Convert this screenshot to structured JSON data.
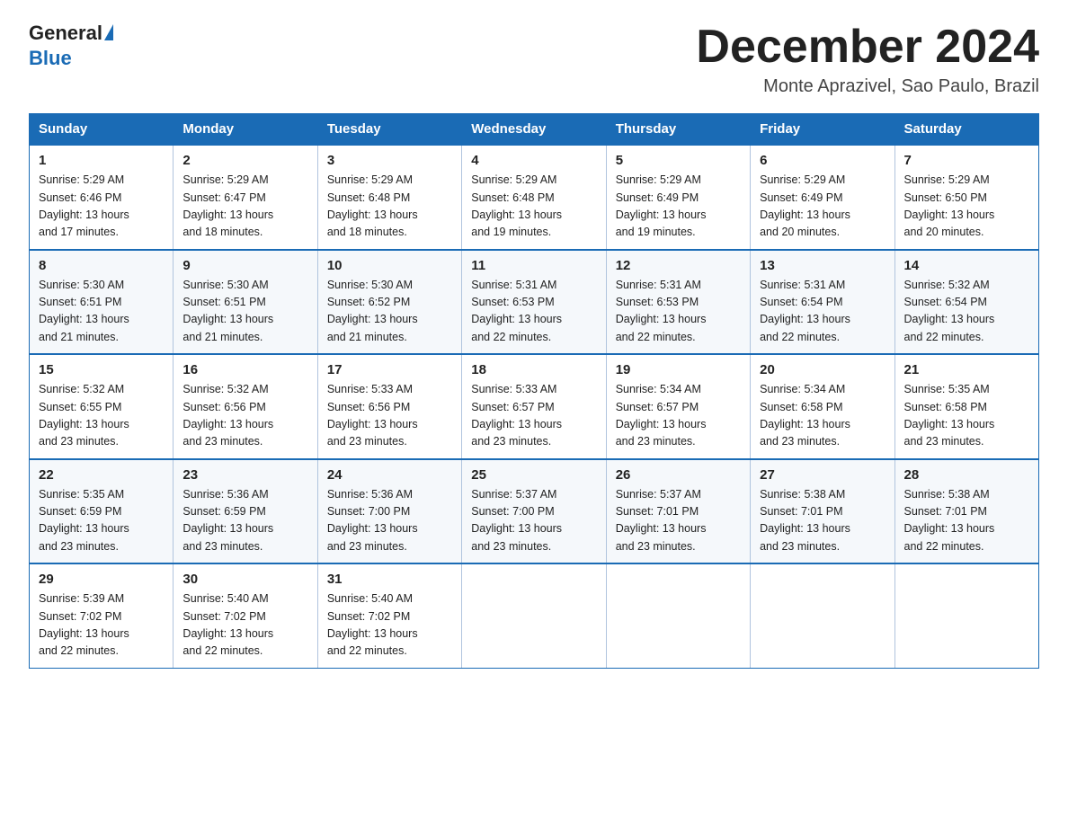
{
  "header": {
    "logo_general": "General",
    "logo_blue": "Blue",
    "month_title": "December 2024",
    "subtitle": "Monte Aprazivel, Sao Paulo, Brazil"
  },
  "weekdays": [
    "Sunday",
    "Monday",
    "Tuesday",
    "Wednesday",
    "Thursday",
    "Friday",
    "Saturday"
  ],
  "weeks": [
    [
      {
        "day": "1",
        "sunrise": "5:29 AM",
        "sunset": "6:46 PM",
        "daylight": "13 hours and 17 minutes."
      },
      {
        "day": "2",
        "sunrise": "5:29 AM",
        "sunset": "6:47 PM",
        "daylight": "13 hours and 18 minutes."
      },
      {
        "day": "3",
        "sunrise": "5:29 AM",
        "sunset": "6:48 PM",
        "daylight": "13 hours and 18 minutes."
      },
      {
        "day": "4",
        "sunrise": "5:29 AM",
        "sunset": "6:48 PM",
        "daylight": "13 hours and 19 minutes."
      },
      {
        "day": "5",
        "sunrise": "5:29 AM",
        "sunset": "6:49 PM",
        "daylight": "13 hours and 19 minutes."
      },
      {
        "day": "6",
        "sunrise": "5:29 AM",
        "sunset": "6:49 PM",
        "daylight": "13 hours and 20 minutes."
      },
      {
        "day": "7",
        "sunrise": "5:29 AM",
        "sunset": "6:50 PM",
        "daylight": "13 hours and 20 minutes."
      }
    ],
    [
      {
        "day": "8",
        "sunrise": "5:30 AM",
        "sunset": "6:51 PM",
        "daylight": "13 hours and 21 minutes."
      },
      {
        "day": "9",
        "sunrise": "5:30 AM",
        "sunset": "6:51 PM",
        "daylight": "13 hours and 21 minutes."
      },
      {
        "day": "10",
        "sunrise": "5:30 AM",
        "sunset": "6:52 PM",
        "daylight": "13 hours and 21 minutes."
      },
      {
        "day": "11",
        "sunrise": "5:31 AM",
        "sunset": "6:53 PM",
        "daylight": "13 hours and 22 minutes."
      },
      {
        "day": "12",
        "sunrise": "5:31 AM",
        "sunset": "6:53 PM",
        "daylight": "13 hours and 22 minutes."
      },
      {
        "day": "13",
        "sunrise": "5:31 AM",
        "sunset": "6:54 PM",
        "daylight": "13 hours and 22 minutes."
      },
      {
        "day": "14",
        "sunrise": "5:32 AM",
        "sunset": "6:54 PM",
        "daylight": "13 hours and 22 minutes."
      }
    ],
    [
      {
        "day": "15",
        "sunrise": "5:32 AM",
        "sunset": "6:55 PM",
        "daylight": "13 hours and 23 minutes."
      },
      {
        "day": "16",
        "sunrise": "5:32 AM",
        "sunset": "6:56 PM",
        "daylight": "13 hours and 23 minutes."
      },
      {
        "day": "17",
        "sunrise": "5:33 AM",
        "sunset": "6:56 PM",
        "daylight": "13 hours and 23 minutes."
      },
      {
        "day": "18",
        "sunrise": "5:33 AM",
        "sunset": "6:57 PM",
        "daylight": "13 hours and 23 minutes."
      },
      {
        "day": "19",
        "sunrise": "5:34 AM",
        "sunset": "6:57 PM",
        "daylight": "13 hours and 23 minutes."
      },
      {
        "day": "20",
        "sunrise": "5:34 AM",
        "sunset": "6:58 PM",
        "daylight": "13 hours and 23 minutes."
      },
      {
        "day": "21",
        "sunrise": "5:35 AM",
        "sunset": "6:58 PM",
        "daylight": "13 hours and 23 minutes."
      }
    ],
    [
      {
        "day": "22",
        "sunrise": "5:35 AM",
        "sunset": "6:59 PM",
        "daylight": "13 hours and 23 minutes."
      },
      {
        "day": "23",
        "sunrise": "5:36 AM",
        "sunset": "6:59 PM",
        "daylight": "13 hours and 23 minutes."
      },
      {
        "day": "24",
        "sunrise": "5:36 AM",
        "sunset": "7:00 PM",
        "daylight": "13 hours and 23 minutes."
      },
      {
        "day": "25",
        "sunrise": "5:37 AM",
        "sunset": "7:00 PM",
        "daylight": "13 hours and 23 minutes."
      },
      {
        "day": "26",
        "sunrise": "5:37 AM",
        "sunset": "7:01 PM",
        "daylight": "13 hours and 23 minutes."
      },
      {
        "day": "27",
        "sunrise": "5:38 AM",
        "sunset": "7:01 PM",
        "daylight": "13 hours and 23 minutes."
      },
      {
        "day": "28",
        "sunrise": "5:38 AM",
        "sunset": "7:01 PM",
        "daylight": "13 hours and 22 minutes."
      }
    ],
    [
      {
        "day": "29",
        "sunrise": "5:39 AM",
        "sunset": "7:02 PM",
        "daylight": "13 hours and 22 minutes."
      },
      {
        "day": "30",
        "sunrise": "5:40 AM",
        "sunset": "7:02 PM",
        "daylight": "13 hours and 22 minutes."
      },
      {
        "day": "31",
        "sunrise": "5:40 AM",
        "sunset": "7:02 PM",
        "daylight": "13 hours and 22 minutes."
      },
      null,
      null,
      null,
      null
    ]
  ],
  "labels": {
    "sunrise": "Sunrise:",
    "sunset": "Sunset:",
    "daylight": "Daylight:"
  }
}
